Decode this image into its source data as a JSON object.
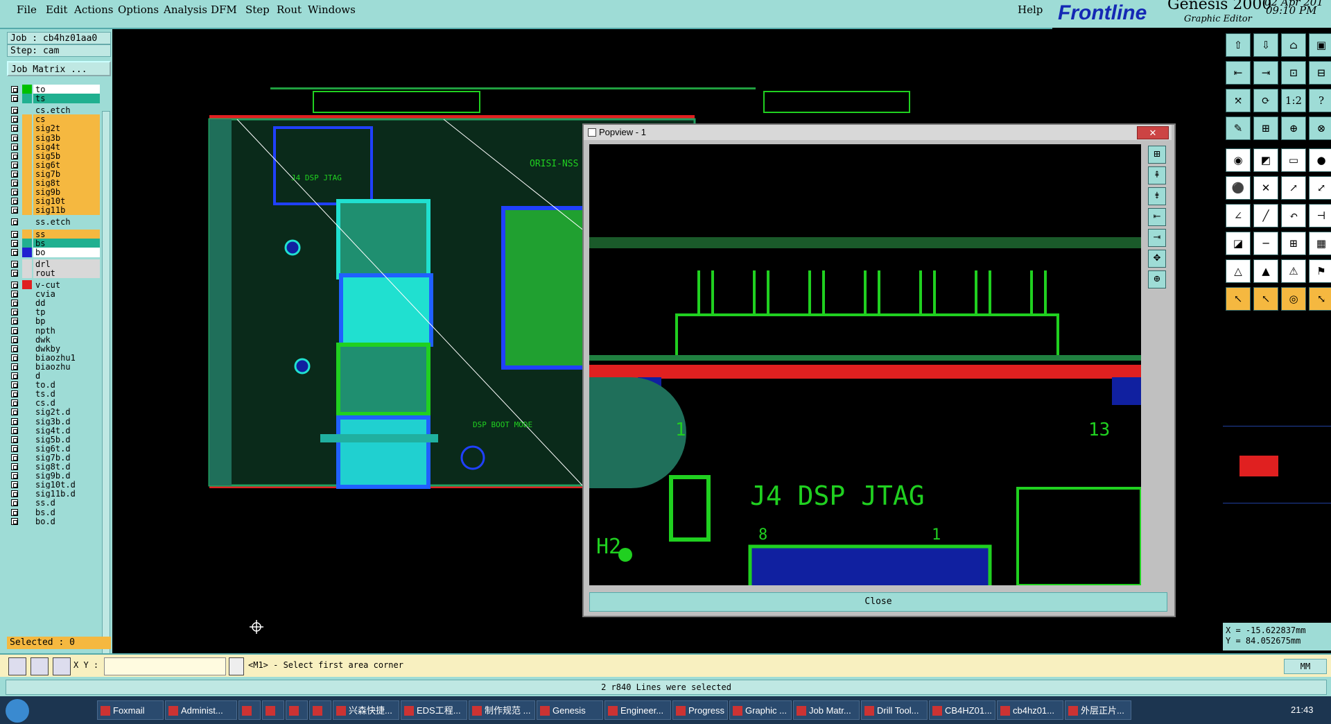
{
  "menu": {
    "items": [
      "File",
      "Edit",
      "Actions",
      "Options",
      "Analysis",
      "DFM",
      "Step",
      "Rout",
      "Windows"
    ],
    "help": "Help"
  },
  "brand": {
    "logo": "Frontline",
    "app": "Genesis 2000",
    "subtitle": "Graphic Editor",
    "date": "02 Apr 201",
    "time": "09:10 PM"
  },
  "job": {
    "job_label": "Job : cb4hz01aa0",
    "step_label": "Step: cam",
    "matrix_button": "Job Matrix ..."
  },
  "layers": [
    {
      "name": "to",
      "color": "#ffffff",
      "swatch": "#00c000"
    },
    {
      "name": "ts",
      "color": "#20b090",
      "swatch": "#20b090"
    },
    {
      "name": "cs.etch",
      "color": "#9edcd6",
      "swatch": ""
    },
    {
      "name": "cs",
      "color": "#f5b840",
      "swatch": ""
    },
    {
      "name": "sig2t",
      "color": "#f5b840",
      "swatch": ""
    },
    {
      "name": "sig3b",
      "color": "#f5b840",
      "swatch": ""
    },
    {
      "name": "sig4t",
      "color": "#f5b840",
      "swatch": ""
    },
    {
      "name": "sig5b",
      "color": "#f5b840",
      "swatch": ""
    },
    {
      "name": "sig6t",
      "color": "#f5b840",
      "swatch": ""
    },
    {
      "name": "sig7b",
      "color": "#f5b840",
      "swatch": ""
    },
    {
      "name": "sig8t",
      "color": "#f5b840",
      "swatch": ""
    },
    {
      "name": "sig9b",
      "color": "#f5b840",
      "swatch": ""
    },
    {
      "name": "sig10t",
      "color": "#f5b840",
      "swatch": ""
    },
    {
      "name": "sig11b",
      "color": "#f5b840",
      "swatch": ""
    },
    {
      "name": "ss.etch",
      "color": "#9edcd6",
      "swatch": ""
    },
    {
      "name": "ss",
      "color": "#f5b840",
      "swatch": ""
    },
    {
      "name": "bs",
      "color": "#20b090",
      "swatch": ""
    },
    {
      "name": "bo",
      "color": "#ffffff",
      "swatch": "#2020d0"
    },
    {
      "name": "drl",
      "color": "#d8d8d8",
      "swatch": ""
    },
    {
      "name": "rout",
      "color": "#d8d8d8",
      "swatch": ""
    },
    {
      "name": "v-cut",
      "color": "#9edcd6",
      "swatch": "#e02020"
    },
    {
      "name": "cvia",
      "color": "#9edcd6",
      "swatch": ""
    },
    {
      "name": "dd",
      "color": "#9edcd6",
      "swatch": ""
    },
    {
      "name": "tp",
      "color": "#9edcd6",
      "swatch": ""
    },
    {
      "name": "bp",
      "color": "#9edcd6",
      "swatch": ""
    },
    {
      "name": "npth",
      "color": "#9edcd6",
      "swatch": ""
    },
    {
      "name": "dwk",
      "color": "#9edcd6",
      "swatch": ""
    },
    {
      "name": "dwkby",
      "color": "#9edcd6",
      "swatch": ""
    },
    {
      "name": "biaozhu1",
      "color": "#9edcd6",
      "swatch": ""
    },
    {
      "name": "biaozhu",
      "color": "#9edcd6",
      "swatch": ""
    },
    {
      "name": "d",
      "color": "#9edcd6",
      "swatch": ""
    },
    {
      "name": "to.d",
      "color": "#9edcd6",
      "swatch": ""
    },
    {
      "name": "ts.d",
      "color": "#9edcd6",
      "swatch": ""
    },
    {
      "name": "cs.d",
      "color": "#9edcd6",
      "swatch": ""
    },
    {
      "name": "sig2t.d",
      "color": "#9edcd6",
      "swatch": ""
    },
    {
      "name": "sig3b.d",
      "color": "#9edcd6",
      "swatch": ""
    },
    {
      "name": "sig4t.d",
      "color": "#9edcd6",
      "swatch": ""
    },
    {
      "name": "sig5b.d",
      "color": "#9edcd6",
      "swatch": ""
    },
    {
      "name": "sig6t.d",
      "color": "#9edcd6",
      "swatch": ""
    },
    {
      "name": "sig7b.d",
      "color": "#9edcd6",
      "swatch": ""
    },
    {
      "name": "sig8t.d",
      "color": "#9edcd6",
      "swatch": ""
    },
    {
      "name": "sig9b.d",
      "color": "#9edcd6",
      "swatch": ""
    },
    {
      "name": "sig10t.d",
      "color": "#9edcd6",
      "swatch": ""
    },
    {
      "name": "sig11b.d",
      "color": "#9edcd6",
      "swatch": ""
    },
    {
      "name": "ss.d",
      "color": "#9edcd6",
      "swatch": ""
    },
    {
      "name": "bs.d",
      "color": "#9edcd6",
      "swatch": ""
    },
    {
      "name": "bo.d",
      "color": "#9edcd6",
      "swatch": ""
    }
  ],
  "selected": "Selected : 0",
  "popview": {
    "title": "Popview - 1",
    "close_x": "✕",
    "close_button": "Close",
    "labels": {
      "pin1": "1",
      "pin13": "13",
      "jtag": "J4 DSP JTAG",
      "pin8": "8",
      "pin1b": "1",
      "h2": "H2"
    }
  },
  "board": {
    "title": "ORISI-NSS",
    "jtag": "J4 DSP JTAG",
    "boot": "DSP BOOT MODE"
  },
  "coords": {
    "x": "X = -15.622837mm",
    "y": "Y = 84.052675mm"
  },
  "command": {
    "xy_label": "X Y :",
    "xy_value": "",
    "prompt": "<M1> - Select first area corner",
    "units": "MM"
  },
  "status": "2 r840 Lines were selected",
  "taskbar": {
    "items": [
      "Foxmail",
      "Administ...",
      "",
      "",
      "",
      "",
      "兴森快捷...",
      "EDS工程...",
      "制作规范 ...",
      "Genesis",
      "Engineer...",
      "Progress",
      "Graphic ...",
      "Job Matr...",
      "Drill Tool...",
      "CB4HZ01...",
      "cb4hz01...",
      "外层正片..."
    ],
    "clock": "21:43"
  },
  "colors": {
    "panel": "#9edcd6",
    "accent_orange": "#f5b840",
    "copper_green": "#20d020",
    "outline_red": "#e02020",
    "pad_blue": "#2020d0"
  }
}
